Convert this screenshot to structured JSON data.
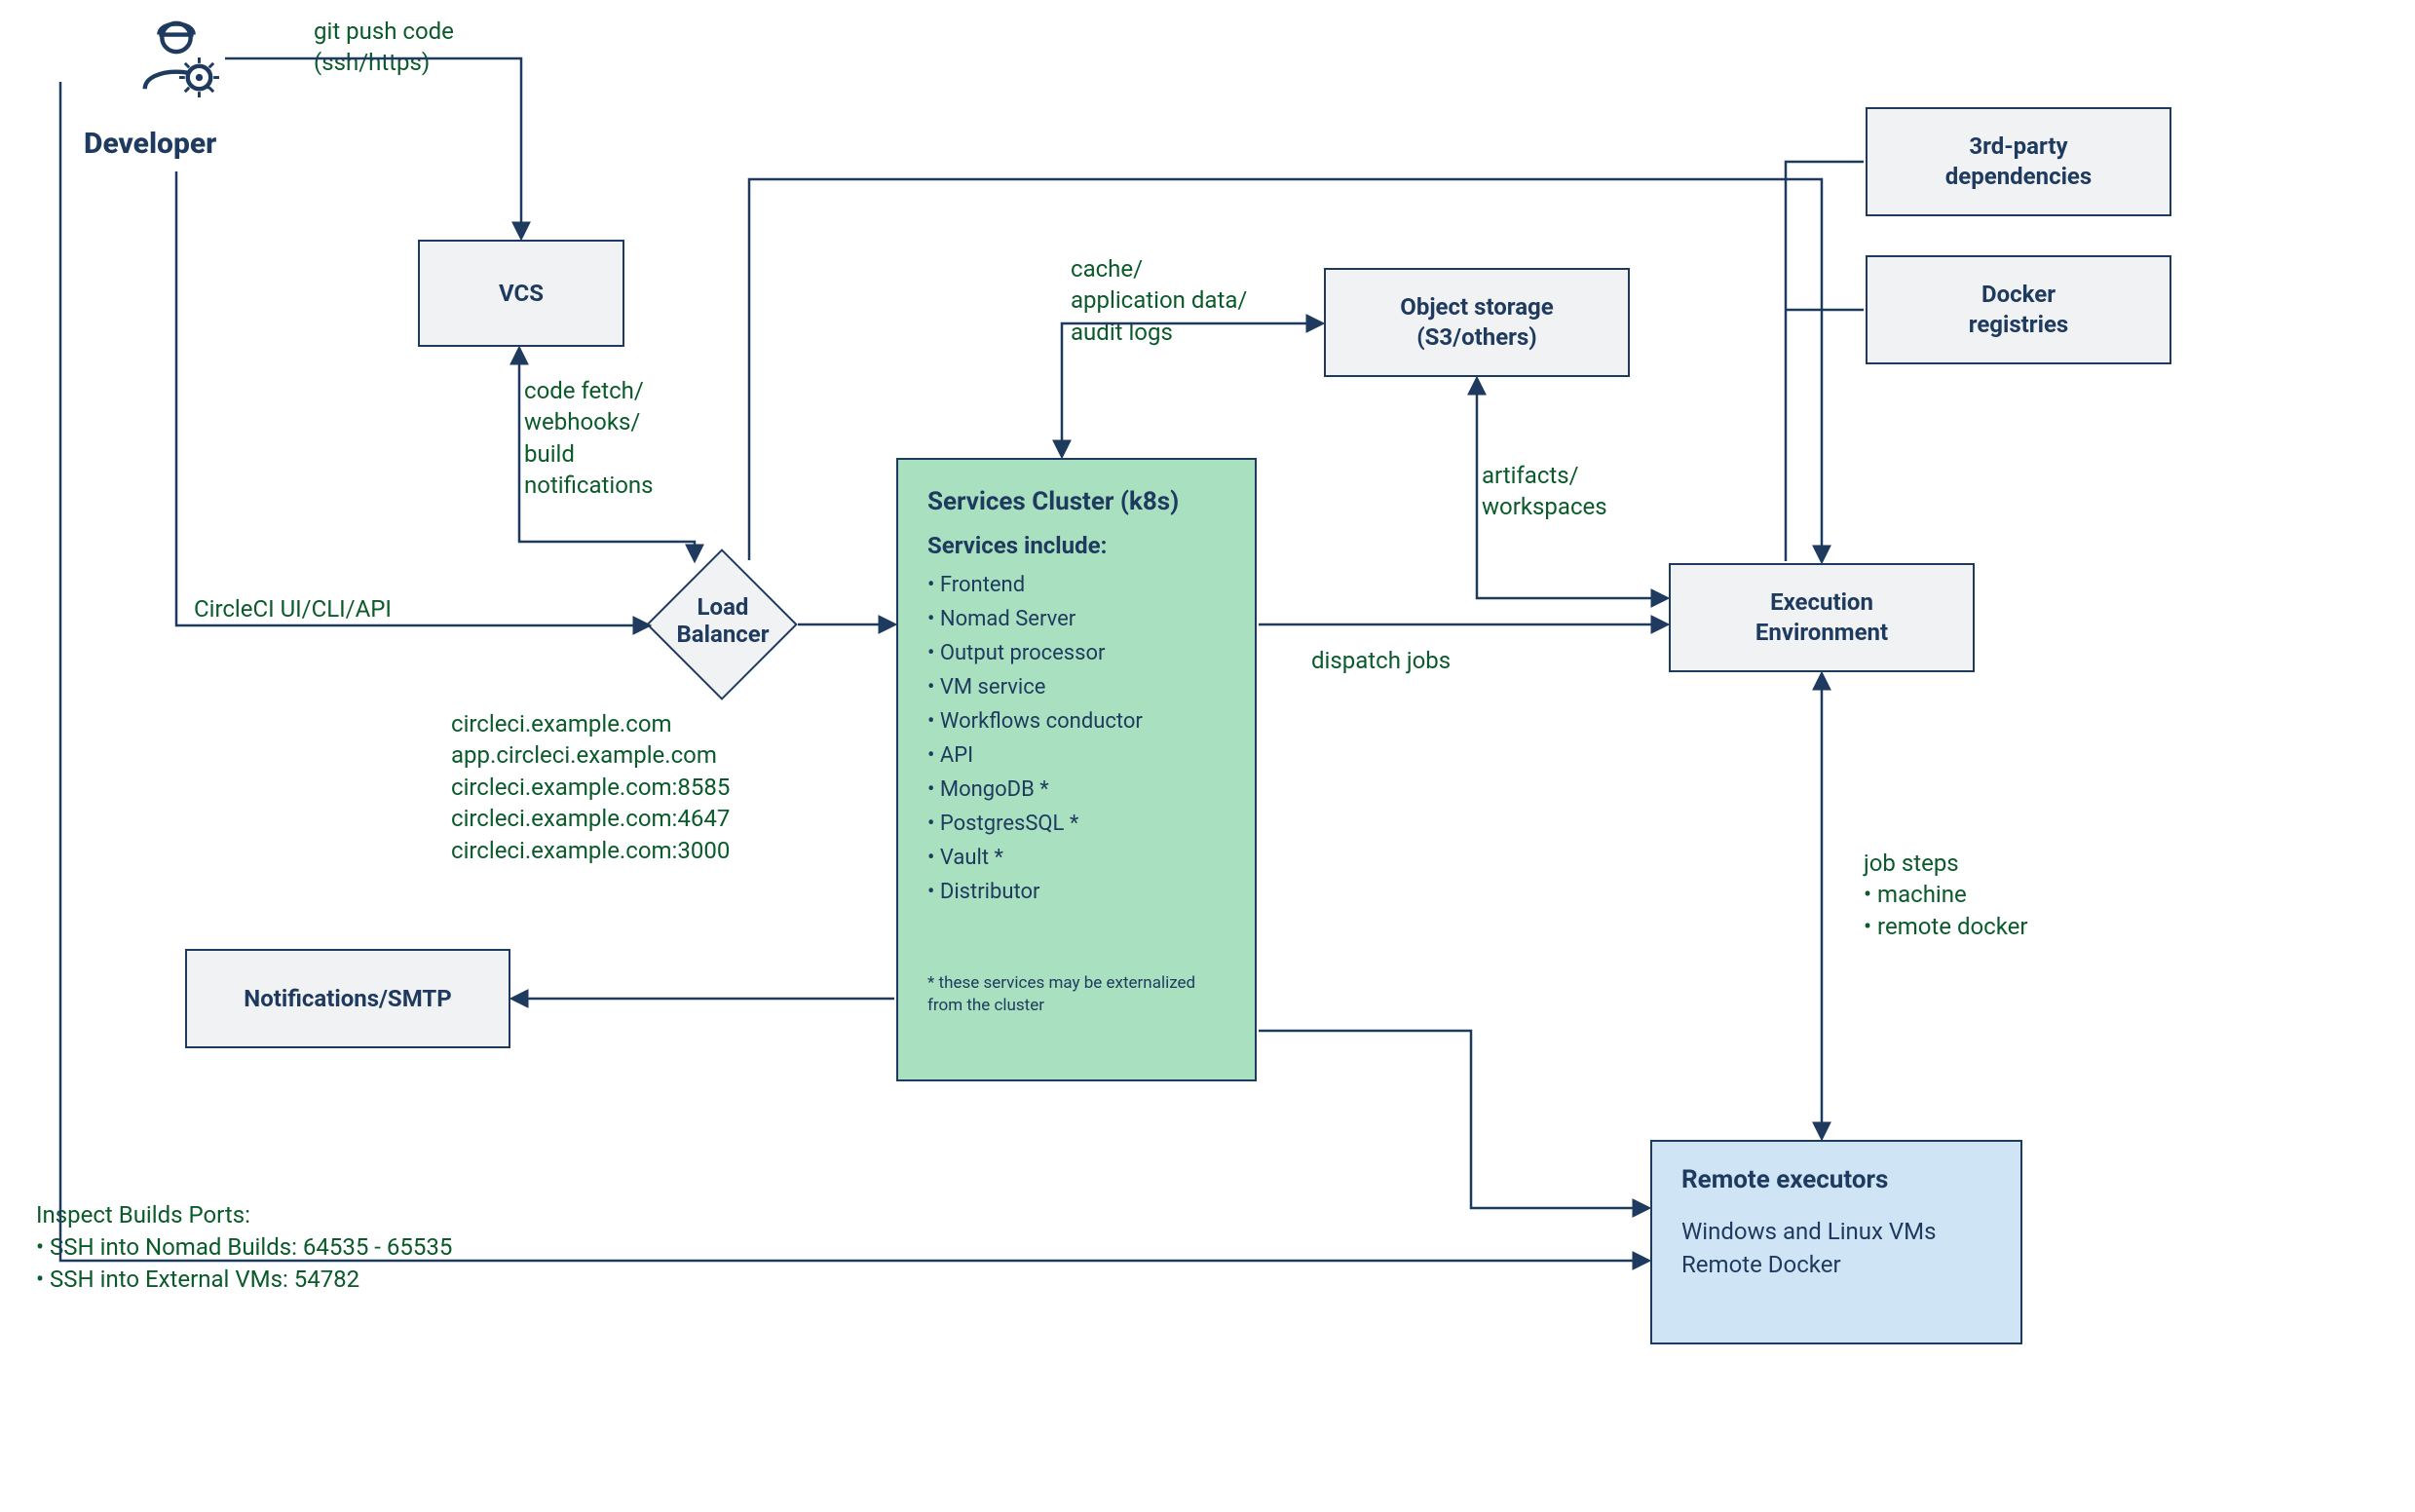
{
  "developer": {
    "label": "Developer"
  },
  "nodes": {
    "vcs": "VCS",
    "load_balancer": "Load\nBalancer",
    "notifications": "Notifications/SMTP",
    "object_storage_l1": "Object storage",
    "object_storage_l2": "(S3/others)",
    "execution_env_l1": "Execution",
    "execution_env_l2": "Environment",
    "third_party_l1": "3rd-party",
    "third_party_l2": "dependencies",
    "docker_reg_l1": "Docker",
    "docker_reg_l2": "registries",
    "services_title": "Services Cluster (k8s)",
    "services_subtitle": "Services include:",
    "services_items": [
      "• Frontend",
      "• Nomad Server",
      "• Output processor",
      "• VM service",
      "• Workflows conductor",
      "• API",
      "• MongoDB *",
      "• PostgresSQL *",
      "• Vault *",
      "• Distributor"
    ],
    "services_note": "* these services may be externalized\nfrom the cluster",
    "remote_executors_title": "Remote executors",
    "remote_executors_items": [
      "Windows and Linux VMs",
      "Remote Docker"
    ]
  },
  "edges": {
    "git_push": "git push code\n(ssh/https)",
    "code_fetch": "code fetch/\nwebhooks/\nbuild\nnotifications",
    "circleci_ui": "CircleCI UI/CLI/API",
    "lb_domains": "circleci.example.com\napp.circleci.example.com\ncircleci.example.com:8585\ncircleci.example.com:4647\ncircleci.example.com:3000",
    "cache": "cache/\napplication data/\naudit logs",
    "artifacts": "artifacts/\nworkspaces",
    "dispatch": "dispatch jobs",
    "job_steps": "job steps\n• machine\n• remote docker",
    "inspect_title": "Inspect Builds Ports:",
    "inspect_l1": "• SSH into Nomad Builds: 64535 - 65535",
    "inspect_l2": "• SSH into External VMs: 54782"
  }
}
